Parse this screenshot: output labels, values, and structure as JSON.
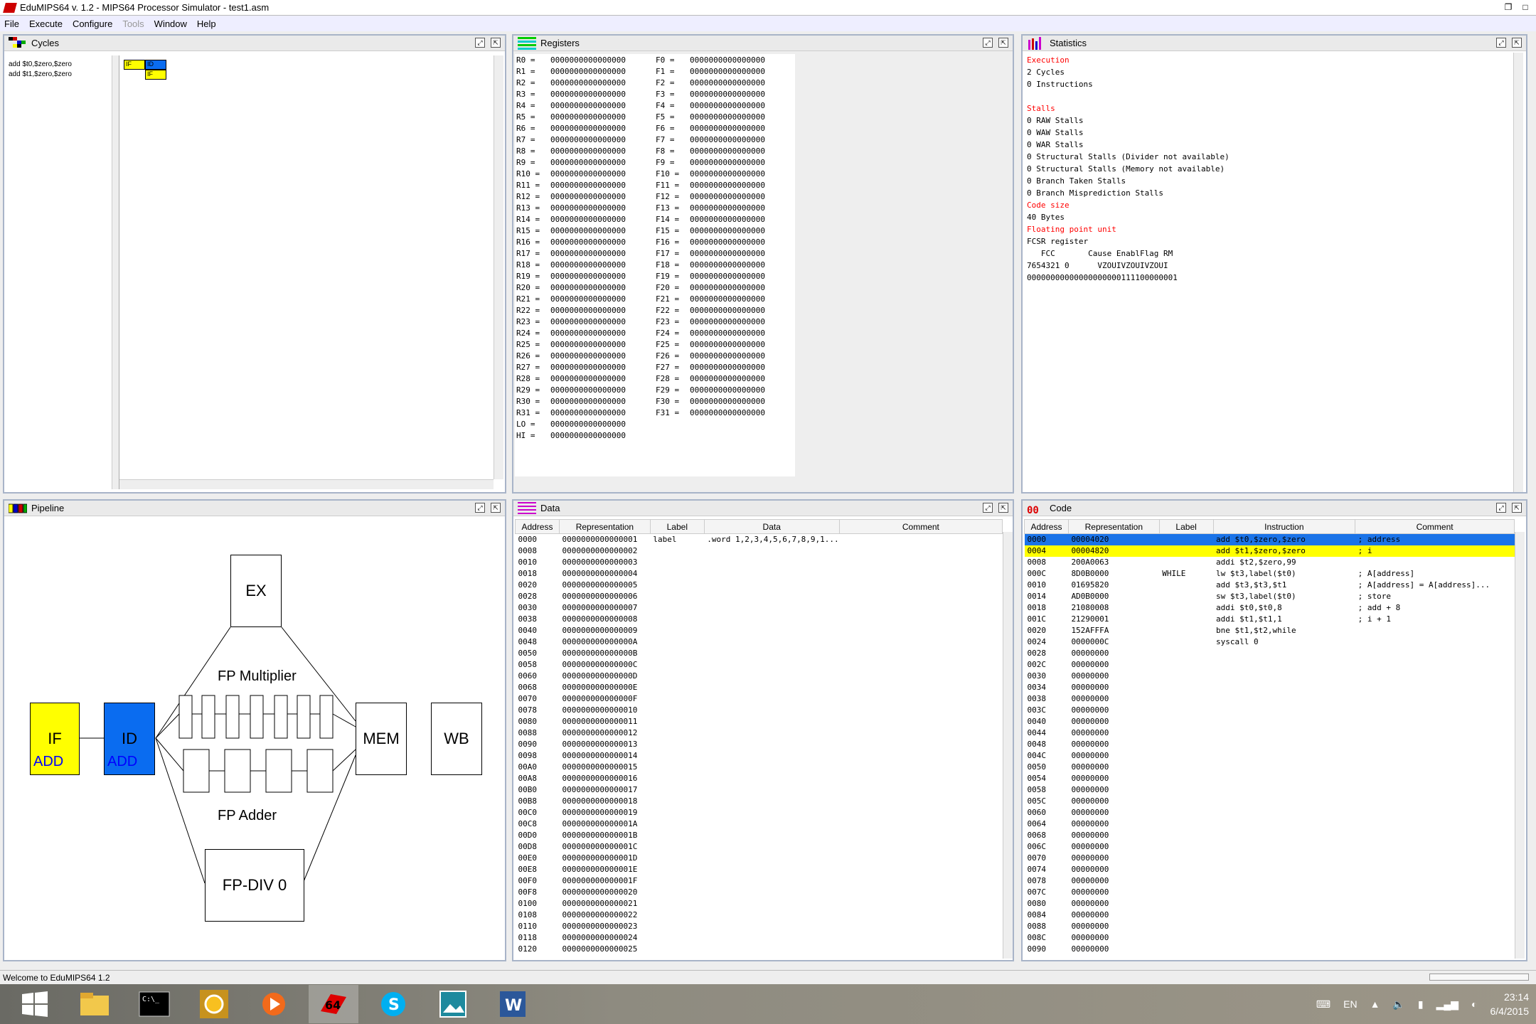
{
  "window": {
    "title": "EduMIPS64 v. 1.2 - MIPS64 Processor Simulator - test1.asm"
  },
  "menu": [
    "File",
    "Execute",
    "Configure",
    "Tools",
    "Window",
    "Help"
  ],
  "menu_disabled": [
    false,
    false,
    false,
    true,
    false,
    false
  ],
  "cycles": {
    "title": "Cycles",
    "instructions": [
      "add $t0,$zero,$zero",
      "add $t1,$zero,$zero"
    ],
    "stages": [
      [
        "IF",
        "ID"
      ],
      [
        "IF"
      ]
    ]
  },
  "registers": {
    "title": "Registers",
    "rows": [
      [
        "R0 =",
        "0000000000000000",
        "F0 =",
        "0000000000000000"
      ],
      [
        "R1 =",
        "0000000000000000",
        "F1 =",
        "0000000000000000"
      ],
      [
        "R2 =",
        "0000000000000000",
        "F2 =",
        "0000000000000000"
      ],
      [
        "R3 =",
        "0000000000000000",
        "F3 =",
        "0000000000000000"
      ],
      [
        "R4 =",
        "0000000000000000",
        "F4 =",
        "0000000000000000"
      ],
      [
        "R5 =",
        "0000000000000000",
        "F5 =",
        "0000000000000000"
      ],
      [
        "R6 =",
        "0000000000000000",
        "F6 =",
        "0000000000000000"
      ],
      [
        "R7 =",
        "0000000000000000",
        "F7 =",
        "0000000000000000"
      ],
      [
        "R8 =",
        "0000000000000000",
        "F8 =",
        "0000000000000000"
      ],
      [
        "R9 =",
        "0000000000000000",
        "F9 =",
        "0000000000000000"
      ],
      [
        "R10 =",
        "0000000000000000",
        "F10 =",
        "0000000000000000"
      ],
      [
        "R11 =",
        "0000000000000000",
        "F11 =",
        "0000000000000000"
      ],
      [
        "R12 =",
        "0000000000000000",
        "F12 =",
        "0000000000000000"
      ],
      [
        "R13 =",
        "0000000000000000",
        "F13 =",
        "0000000000000000"
      ],
      [
        "R14 =",
        "0000000000000000",
        "F14 =",
        "0000000000000000"
      ],
      [
        "R15 =",
        "0000000000000000",
        "F15 =",
        "0000000000000000"
      ],
      [
        "R16 =",
        "0000000000000000",
        "F16 =",
        "0000000000000000"
      ],
      [
        "R17 =",
        "0000000000000000",
        "F17 =",
        "0000000000000000"
      ],
      [
        "R18 =",
        "0000000000000000",
        "F18 =",
        "0000000000000000"
      ],
      [
        "R19 =",
        "0000000000000000",
        "F19 =",
        "0000000000000000"
      ],
      [
        "R20 =",
        "0000000000000000",
        "F20 =",
        "0000000000000000"
      ],
      [
        "R21 =",
        "0000000000000000",
        "F21 =",
        "0000000000000000"
      ],
      [
        "R22 =",
        "0000000000000000",
        "F22 =",
        "0000000000000000"
      ],
      [
        "R23 =",
        "0000000000000000",
        "F23 =",
        "0000000000000000"
      ],
      [
        "R24 =",
        "0000000000000000",
        "F24 =",
        "0000000000000000"
      ],
      [
        "R25 =",
        "0000000000000000",
        "F25 =",
        "0000000000000000"
      ],
      [
        "R26 =",
        "0000000000000000",
        "F26 =",
        "0000000000000000"
      ],
      [
        "R27 =",
        "0000000000000000",
        "F27 =",
        "0000000000000000"
      ],
      [
        "R28 =",
        "0000000000000000",
        "F28 =",
        "0000000000000000"
      ],
      [
        "R29 =",
        "0000000000000000",
        "F29 =",
        "0000000000000000"
      ],
      [
        "R30 =",
        "0000000000000000",
        "F30 =",
        "0000000000000000"
      ],
      [
        "R31 =",
        "0000000000000000",
        "F31 =",
        "0000000000000000"
      ],
      [
        "LO =",
        "0000000000000000",
        "",
        ""
      ],
      [
        "HI =",
        "0000000000000000",
        "",
        ""
      ]
    ]
  },
  "statistics": {
    "title": "Statistics",
    "lines": [
      {
        "t": "Execution",
        "red": true
      },
      {
        "t": "2 Cycles"
      },
      {
        "t": "0 Instructions"
      },
      {
        "t": ""
      },
      {
        "t": "Stalls",
        "red": true
      },
      {
        "t": "0 RAW Stalls"
      },
      {
        "t": "0 WAW Stalls"
      },
      {
        "t": "0 WAR Stalls"
      },
      {
        "t": "0 Structural Stalls (Divider not available)"
      },
      {
        "t": "0 Structural Stalls (Memory not available)"
      },
      {
        "t": "0 Branch Taken Stalls"
      },
      {
        "t": "0 Branch Misprediction Stalls"
      },
      {
        "t": "Code size",
        "red": true
      },
      {
        "t": "40 Bytes"
      },
      {
        "t": "Floating point unit",
        "red": true
      },
      {
        "t": "FCSR register"
      },
      {
        "t": "   FCC       Cause EnablFlag RM"
      },
      {
        "t": "7654321 0      VZOUIVZOUIVZOUI"
      },
      {
        "t": "00000000000000000000111100000001"
      }
    ]
  },
  "pipeline": {
    "title": "Pipeline",
    "if": "IF",
    "if_instr": "ADD",
    "id": "ID",
    "id_instr": "ADD",
    "ex": "EX",
    "mem": "MEM",
    "wb": "WB",
    "fp_mult": "FP Multiplier",
    "fp_add": "FP Adder",
    "fp_div": "FP-DIV 0"
  },
  "data": {
    "title": "Data",
    "headers": [
      "Address",
      "Representation",
      "Label",
      "Data",
      "Comment"
    ],
    "rows": [
      [
        "0000",
        "0000000000000001",
        "label",
        ".word 1,2,3,4,5,6,7,8,9,1...",
        ""
      ],
      [
        "0008",
        "0000000000000002",
        "",
        "",
        ""
      ],
      [
        "0010",
        "0000000000000003",
        "",
        "",
        ""
      ],
      [
        "0018",
        "0000000000000004",
        "",
        "",
        ""
      ],
      [
        "0020",
        "0000000000000005",
        "",
        "",
        ""
      ],
      [
        "0028",
        "0000000000000006",
        "",
        "",
        ""
      ],
      [
        "0030",
        "0000000000000007",
        "",
        "",
        ""
      ],
      [
        "0038",
        "0000000000000008",
        "",
        "",
        ""
      ],
      [
        "0040",
        "0000000000000009",
        "",
        "",
        ""
      ],
      [
        "0048",
        "000000000000000A",
        "",
        "",
        ""
      ],
      [
        "0050",
        "000000000000000B",
        "",
        "",
        ""
      ],
      [
        "0058",
        "000000000000000C",
        "",
        "",
        ""
      ],
      [
        "0060",
        "000000000000000D",
        "",
        "",
        ""
      ],
      [
        "0068",
        "000000000000000E",
        "",
        "",
        ""
      ],
      [
        "0070",
        "000000000000000F",
        "",
        "",
        ""
      ],
      [
        "0078",
        "0000000000000010",
        "",
        "",
        ""
      ],
      [
        "0080",
        "0000000000000011",
        "",
        "",
        ""
      ],
      [
        "0088",
        "0000000000000012",
        "",
        "",
        ""
      ],
      [
        "0090",
        "0000000000000013",
        "",
        "",
        ""
      ],
      [
        "0098",
        "0000000000000014",
        "",
        "",
        ""
      ],
      [
        "00A0",
        "0000000000000015",
        "",
        "",
        ""
      ],
      [
        "00A8",
        "0000000000000016",
        "",
        "",
        ""
      ],
      [
        "00B0",
        "0000000000000017",
        "",
        "",
        ""
      ],
      [
        "00B8",
        "0000000000000018",
        "",
        "",
        ""
      ],
      [
        "00C0",
        "0000000000000019",
        "",
        "",
        ""
      ],
      [
        "00C8",
        "000000000000001A",
        "",
        "",
        ""
      ],
      [
        "00D0",
        "000000000000001B",
        "",
        "",
        ""
      ],
      [
        "00D8",
        "000000000000001C",
        "",
        "",
        ""
      ],
      [
        "00E0",
        "000000000000001D",
        "",
        "",
        ""
      ],
      [
        "00E8",
        "000000000000001E",
        "",
        "",
        ""
      ],
      [
        "00F0",
        "000000000000001F",
        "",
        "",
        ""
      ],
      [
        "00F8",
        "0000000000000020",
        "",
        "",
        ""
      ],
      [
        "0100",
        "0000000000000021",
        "",
        "",
        ""
      ],
      [
        "0108",
        "0000000000000022",
        "",
        "",
        ""
      ],
      [
        "0110",
        "0000000000000023",
        "",
        "",
        ""
      ],
      [
        "0118",
        "0000000000000024",
        "",
        "",
        ""
      ],
      [
        "0120",
        "0000000000000025",
        "",
        "",
        ""
      ]
    ]
  },
  "code": {
    "title": "Code",
    "headers": [
      "Address",
      "Representation",
      "Label",
      "Instruction",
      "Comment"
    ],
    "rows": [
      [
        "0000",
        "00004020",
        "",
        "add $t0,$zero,$zero",
        "; address"
      ],
      [
        "0004",
        "00004820",
        "",
        "add $t1,$zero,$zero",
        "; i"
      ],
      [
        "0008",
        "200A0063",
        "",
        "addi $t2,$zero,99",
        ""
      ],
      [
        "000C",
        "8D0B0000",
        "WHILE",
        "lw $t3,label($t0)",
        "; A[address]"
      ],
      [
        "0010",
        "01695820",
        "",
        "add $t3,$t3,$t1",
        "; A[address] = A[address]..."
      ],
      [
        "0014",
        "AD0B0000",
        "",
        "sw $t3,label($t0)",
        "; store"
      ],
      [
        "0018",
        "21080008",
        "",
        "addi $t0,$t0,8",
        "; add + 8"
      ],
      [
        "001C",
        "21290001",
        "",
        "addi $t1,$t1,1",
        "; i + 1"
      ],
      [
        "0020",
        "152AFFFA",
        "",
        "bne $t1,$t2,while",
        ""
      ],
      [
        "0024",
        "0000000C",
        "",
        "syscall 0",
        ""
      ],
      [
        "0028",
        "00000000",
        "",
        "",
        ""
      ],
      [
        "002C",
        "00000000",
        "",
        "",
        ""
      ],
      [
        "0030",
        "00000000",
        "",
        "",
        ""
      ],
      [
        "0034",
        "00000000",
        "",
        "",
        ""
      ],
      [
        "0038",
        "00000000",
        "",
        "",
        ""
      ],
      [
        "003C",
        "00000000",
        "",
        "",
        ""
      ],
      [
        "0040",
        "00000000",
        "",
        "",
        ""
      ],
      [
        "0044",
        "00000000",
        "",
        "",
        ""
      ],
      [
        "0048",
        "00000000",
        "",
        "",
        ""
      ],
      [
        "004C",
        "00000000",
        "",
        "",
        ""
      ],
      [
        "0050",
        "00000000",
        "",
        "",
        ""
      ],
      [
        "0054",
        "00000000",
        "",
        "",
        ""
      ],
      [
        "0058",
        "00000000",
        "",
        "",
        ""
      ],
      [
        "005C",
        "00000000",
        "",
        "",
        ""
      ],
      [
        "0060",
        "00000000",
        "",
        "",
        ""
      ],
      [
        "0064",
        "00000000",
        "",
        "",
        ""
      ],
      [
        "0068",
        "00000000",
        "",
        "",
        ""
      ],
      [
        "006C",
        "00000000",
        "",
        "",
        ""
      ],
      [
        "0070",
        "00000000",
        "",
        "",
        ""
      ],
      [
        "0074",
        "00000000",
        "",
        "",
        ""
      ],
      [
        "0078",
        "00000000",
        "",
        "",
        ""
      ],
      [
        "007C",
        "00000000",
        "",
        "",
        ""
      ],
      [
        "0080",
        "00000000",
        "",
        "",
        ""
      ],
      [
        "0084",
        "00000000",
        "",
        "",
        ""
      ],
      [
        "0088",
        "00000000",
        "",
        "",
        ""
      ],
      [
        "008C",
        "00000000",
        "",
        "",
        ""
      ],
      [
        "0090",
        "00000000",
        "",
        "",
        ""
      ]
    ],
    "row_colors": {
      "0": "#1a73e8",
      "1": "#ffff00"
    }
  },
  "colors": {
    "if": "#ffff00",
    "id": "#0a6cf0",
    "stat_red": "#ff0000",
    "instr_blue": "#0000ff"
  },
  "status": {
    "text": "Welcome to EduMIPS64 1.2"
  },
  "taskbar": {
    "apps": [
      "windows-start-icon",
      "file-explorer-icon",
      "command-prompt-icon",
      "chrome-icon",
      "media-player-icon",
      "edumips-icon",
      "skype-icon",
      "photos-icon",
      "word-icon"
    ],
    "lang": "EN",
    "time": "23:14",
    "date": "6/4/2015"
  }
}
